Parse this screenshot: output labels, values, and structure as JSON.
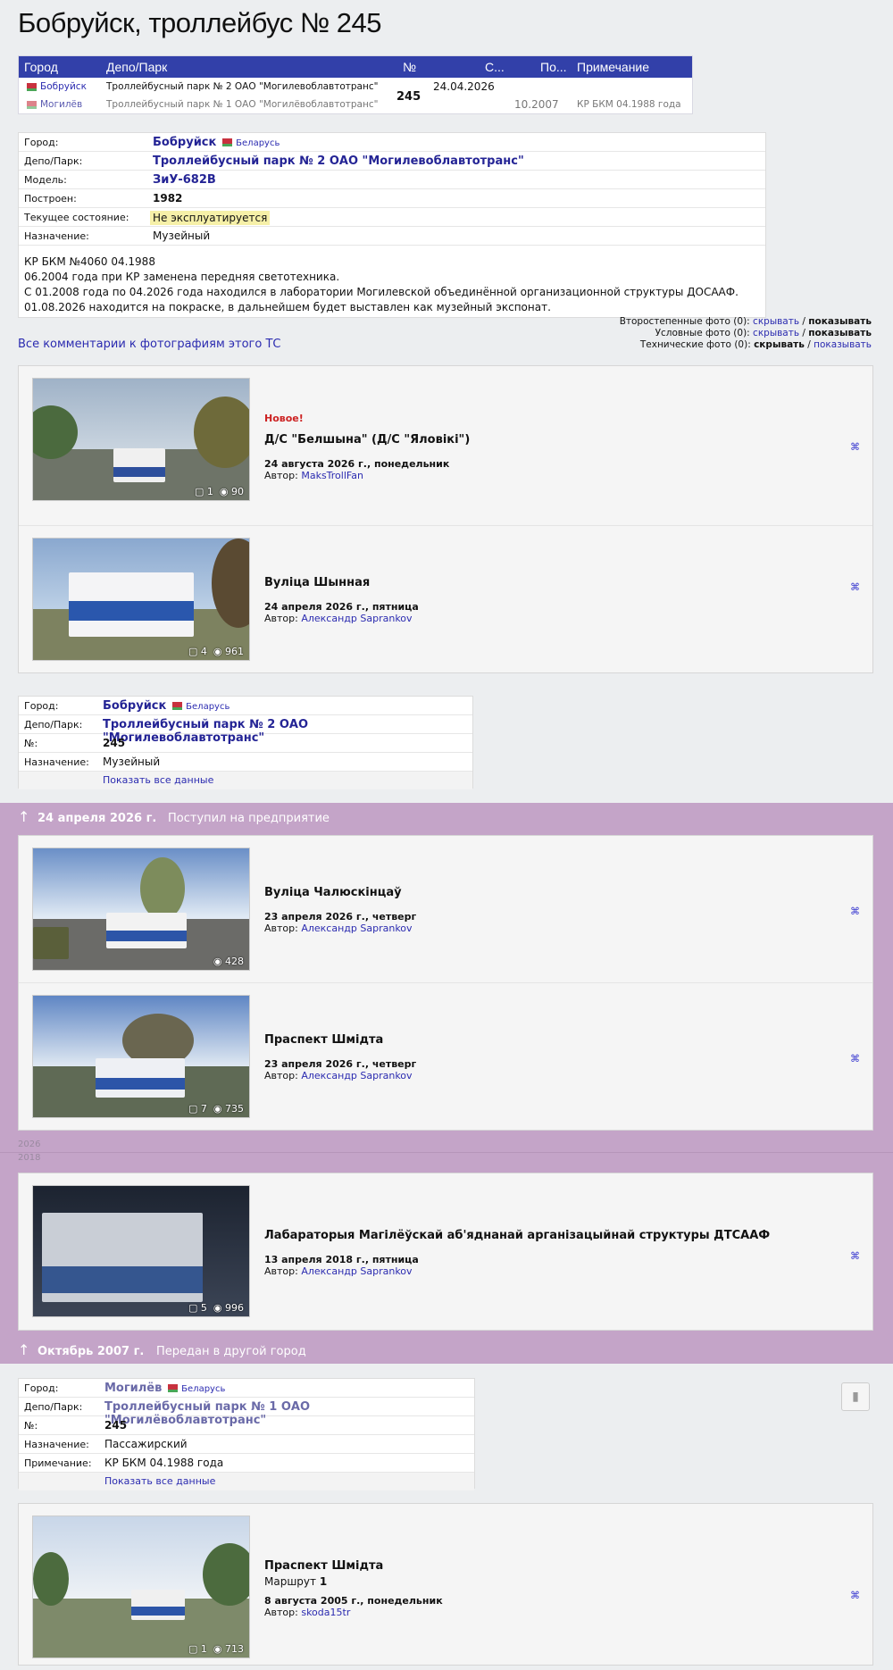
{
  "title": "Бобруйск, троллейбус № 245",
  "history_table": {
    "headers": [
      "Город",
      "Депо/Парк",
      "№",
      "С...",
      "По...",
      "Примечание"
    ],
    "number": "245",
    "rows": [
      {
        "city": "Бобруйск",
        "depot": "Троллейбусный парк № 2 ОАО \"Могилевоблавтотранс\"",
        "from": "24.04.2026",
        "to": "",
        "note": ""
      },
      {
        "city": "Могилёв",
        "depot": "Троллейбусный парк № 1 ОАО \"Могилёвоблавтотранс\"",
        "from": "",
        "to": "10.2007",
        "note": "КР БКМ 04.1988 года"
      }
    ]
  },
  "details": {
    "city_label": "Город:",
    "city": "Бобруйск",
    "country": "Беларусь",
    "depot_label": "Депо/Парк:",
    "depot": "Троллейбусный парк № 2 ОАО \"Могилевоблавтотранс\"",
    "model_label": "Модель:",
    "model": "ЗиУ-682В",
    "built_label": "Построен:",
    "built": "1982",
    "state_label": "Текущее состояние:",
    "state": "Не эксплуатируется",
    "purpose_label": "Назначение:",
    "purpose": "Музейный",
    "notes": [
      "КР БКМ №4060 04.1988",
      "06.2004 года при КР заменена передняя светотехника.",
      "С 01.2008 года по 04.2026 года находился в лаборатории Могилевской объединённой организационной структуры ДОСААФ.",
      "01.08.2026 находится на покраске, в дальнейшем будет выставлен как музейный экспонат."
    ]
  },
  "photo_filters": [
    {
      "label": "Второстепенные фото (0):",
      "hide": "скрывать",
      "show": "показывать"
    },
    {
      "label": "Условные фото (0):",
      "hide": "скрывать",
      "show": "показывать"
    },
    {
      "label": "Технические фото (0):",
      "hide": "скрывать",
      "show": "показывать"
    }
  ],
  "all_comments_link": "Все комментарии к фотографиям этого ТС",
  "author_prefix": "Автор:",
  "photos_group1": [
    {
      "new": "Новое!",
      "place": "Д/С \"Белшына\" (Д/С \"Яловікі\")",
      "date": "24 августа 2026 г., понедельник",
      "author": "MaksTrollFan",
      "comments": "1",
      "views": "90"
    },
    {
      "new": "",
      "place": "Вуліца Шынная",
      "date": "24 апреля 2026 г., пятница",
      "author": "Александр Saprankov",
      "comments": "4",
      "views": "961"
    }
  ],
  "assignment1": {
    "city_label": "Город:",
    "city": "Бобруйск",
    "country": "Беларусь",
    "depot_label": "Депо/Парк:",
    "depot": "Троллейбусный парк № 2 ОАО \"Могилевоблавтотранс\"",
    "num_label": "№:",
    "num": "245",
    "purpose_label": "Назначение:",
    "purpose": "Музейный",
    "show_all": "Показать все данные"
  },
  "event1": {
    "arrow": "↑",
    "date": "24 апреля 2026 г.",
    "text": "Поступил на предприятие"
  },
  "photos_group2": [
    {
      "place": "Вуліца Чалюскінцаў",
      "date": "23 апреля 2026 г., четверг",
      "author": "Александр Saprankov",
      "comments": "",
      "views": "428"
    },
    {
      "place": "Праспект Шмідта",
      "date": "23 апреля 2026 г., четверг",
      "author": "Александр Saprankov",
      "comments": "7",
      "views": "735"
    }
  ],
  "year_marks": [
    "2026",
    "2018"
  ],
  "photos_group3": [
    {
      "place": "Лабараторыя Магілёўскай аб'яднанай арганізацыйнай структуры ДТСААФ",
      "date": "13 апреля 2018 г., пятница",
      "author": "Александр Saprankov",
      "comments": "5",
      "views": "996"
    }
  ],
  "event2": {
    "arrow": "↑",
    "date": "Октябрь 2007 г.",
    "text": "Передан в другой город"
  },
  "assignment2": {
    "city_label": "Город:",
    "city": "Могилёв",
    "country": "Беларусь",
    "depot_label": "Депо/Парк:",
    "depot": "Троллейбусный парк № 1 ОАО \"Могилёвоблавтотранс\"",
    "num_label": "№:",
    "num": "245",
    "purpose_label": "Назначение:",
    "purpose": "Пассажирский",
    "note_label": "Примечание:",
    "note": "КР БКМ 04.1988 года",
    "show_all": "Показать все данные"
  },
  "photos_group4": [
    {
      "place": "Праспект Шмідта",
      "route_label": "Маршрут",
      "route": "1",
      "date": "8 августа 2005 г., понедельник",
      "author": "skoda15tr",
      "comments": "1",
      "views": "713"
    }
  ],
  "icons": {
    "comment": "comment-icon",
    "eye": "eye-icon",
    "star": "favorite-icon",
    "trash": "trash-icon"
  }
}
